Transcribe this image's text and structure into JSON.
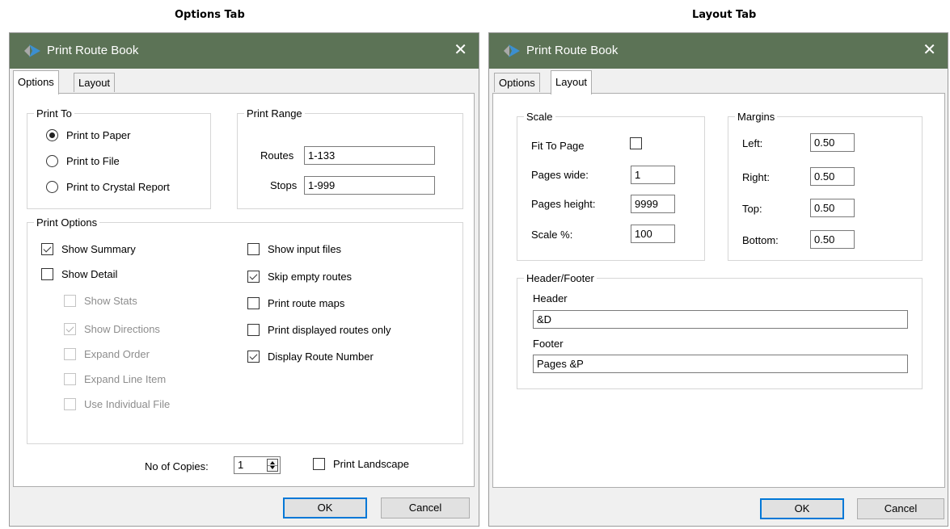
{
  "captions": {
    "left": "Options Tab",
    "right": "Layout Tab"
  },
  "colors": {
    "titlebar": "#5c7356",
    "default_button_border": "#0078d7",
    "logo_blue": "#3c8fd0",
    "logo_gray": "#a9a9a9"
  },
  "options_dialog": {
    "title": "Print Route Book",
    "close_glyph": "✕",
    "tabs": [
      "Options",
      "Layout"
    ],
    "active_tab": "Options",
    "print_to": {
      "legend": "Print To",
      "options": [
        {
          "label": "Print to Paper",
          "selected": true
        },
        {
          "label": "Print to File",
          "selected": false
        },
        {
          "label": "Print to Crystal Report",
          "selected": false
        }
      ]
    },
    "print_range": {
      "legend": "Print Range",
      "routes_label": "Routes",
      "routes_value": "1-133",
      "stops_label": "Stops",
      "stops_value": "1-999"
    },
    "print_options": {
      "legend": "Print Options",
      "left": [
        {
          "label": "Show Summary",
          "checked": true,
          "enabled": true
        },
        {
          "label": "Show Detail",
          "checked": false,
          "enabled": true
        },
        {
          "label": "Show Stats",
          "checked": false,
          "enabled": false
        },
        {
          "label": "Show Directions",
          "checked": true,
          "enabled": false
        },
        {
          "label": "Expand Order",
          "checked": false,
          "enabled": false
        },
        {
          "label": "Expand Line Item",
          "checked": false,
          "enabled": false
        },
        {
          "label": "Use Individual File",
          "checked": false,
          "enabled": false
        }
      ],
      "right": [
        {
          "label": "Show input files",
          "checked": false
        },
        {
          "label": "Skip empty routes",
          "checked": true
        },
        {
          "label": "Print route maps",
          "checked": false
        },
        {
          "label": "Print displayed routes only",
          "checked": false
        },
        {
          "label": "Display Route Number",
          "checked": true
        }
      ]
    },
    "copies_label": "No of Copies:",
    "copies_value": "1",
    "print_landscape": {
      "label": "Print Landscape",
      "checked": false
    },
    "ok_label": "OK",
    "cancel_label": "Cancel"
  },
  "layout_dialog": {
    "title": "Print Route Book",
    "close_glyph": "✕",
    "tabs": [
      "Options",
      "Layout"
    ],
    "active_tab": "Layout",
    "scale": {
      "legend": "Scale",
      "fit_to_page_label": "Fit To Page",
      "fit_to_page_checked": false,
      "pages_wide_label": "Pages wide:",
      "pages_wide_value": "1",
      "pages_height_label": "Pages height:",
      "pages_height_value": "9999",
      "scale_label": "Scale %:",
      "scale_value": "100"
    },
    "margins": {
      "legend": "Margins",
      "left_label": "Left:",
      "left_value": "0.50",
      "right_label": "Right:",
      "right_value": "0.50",
      "top_label": "Top:",
      "top_value": "0.50",
      "bottom_label": "Bottom:",
      "bottom_value": "0.50"
    },
    "header_footer": {
      "legend": "Header/Footer",
      "header_label": "Header",
      "header_value": "&D",
      "footer_label": "Footer",
      "footer_value": "Pages &P"
    },
    "ok_label": "OK",
    "cancel_label": "Cancel"
  }
}
